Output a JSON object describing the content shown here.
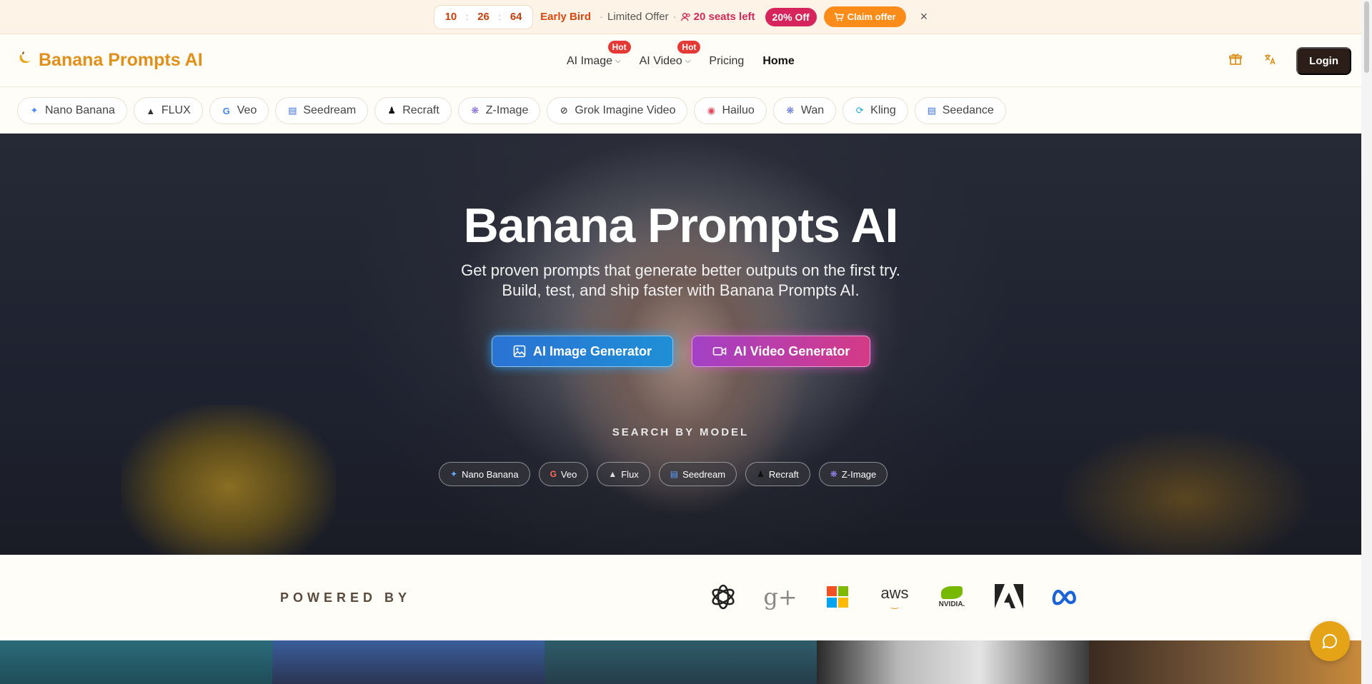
{
  "promo": {
    "timer": {
      "h": "10",
      "sep": ":",
      "m": "26",
      "s": "64"
    },
    "early_bird": "Early Bird",
    "separator": "·",
    "limited_offer": "Limited Offer",
    "seats_left": "20 seats left",
    "off_badge": "20% Off",
    "claim_label": "Claim offer",
    "close_glyph": "×"
  },
  "header": {
    "brand": "Banana Prompts AI",
    "nav": [
      {
        "label": "AI Image",
        "hot": "Hot"
      },
      {
        "label": "AI Video",
        "hot": "Hot"
      },
      {
        "label": "Pricing"
      },
      {
        "label": "Home"
      }
    ],
    "login_label": "Login"
  },
  "model_chips": [
    {
      "label": "Nano Banana",
      "icon": "sparkle-icon"
    },
    {
      "label": "FLUX",
      "icon": "flux-icon"
    },
    {
      "label": "Veo",
      "icon": "google-icon"
    },
    {
      "label": "Seedream",
      "icon": "bars-icon"
    },
    {
      "label": "Recraft",
      "icon": "recraft-icon"
    },
    {
      "label": "Z-Image",
      "icon": "zimage-icon"
    },
    {
      "label": "Grok Imagine Video",
      "icon": "grok-icon"
    },
    {
      "label": "Hailuo",
      "icon": "hailuo-icon"
    },
    {
      "label": "Wan",
      "icon": "wan-icon"
    },
    {
      "label": "Kling",
      "icon": "kling-icon"
    },
    {
      "label": "Seedance",
      "icon": "bars-icon"
    }
  ],
  "hero": {
    "title": "Banana Prompts AI",
    "subtitle_line1": "Get proven prompts that generate better outputs on the first try.",
    "subtitle_line2": "Build, test, and ship faster with Banana Prompts AI.",
    "image_btn": "AI Image Generator",
    "video_btn": "AI Video Generator",
    "search_label": "SEARCH BY MODEL",
    "search_chips": [
      {
        "label": "Nano Banana",
        "icon": "sparkle-icon"
      },
      {
        "label": "Veo",
        "icon": "google-icon"
      },
      {
        "label": "Flux",
        "icon": "flux-icon"
      },
      {
        "label": "Seedream",
        "icon": "bars-icon"
      },
      {
        "label": "Recraft",
        "icon": "recraft-icon"
      },
      {
        "label": "Z-Image",
        "icon": "zimage-icon"
      }
    ]
  },
  "powered": {
    "label": "POWERED BY",
    "brands": [
      "openai-logo",
      "google-plus-logo",
      "microsoft-logo",
      "aws-logo",
      "nvidia-logo",
      "adobe-logo",
      "meta-logo"
    ],
    "aws_text": "aws",
    "nvidia_text": "NVIDIA.",
    "gplus_text": "g+"
  },
  "colors": {
    "accent": "#e0901a",
    "promo_bg": "#fdf3e6",
    "claim": "#fb8c1a",
    "badge": "#d6245c",
    "login_bg": "#2b1d17"
  }
}
